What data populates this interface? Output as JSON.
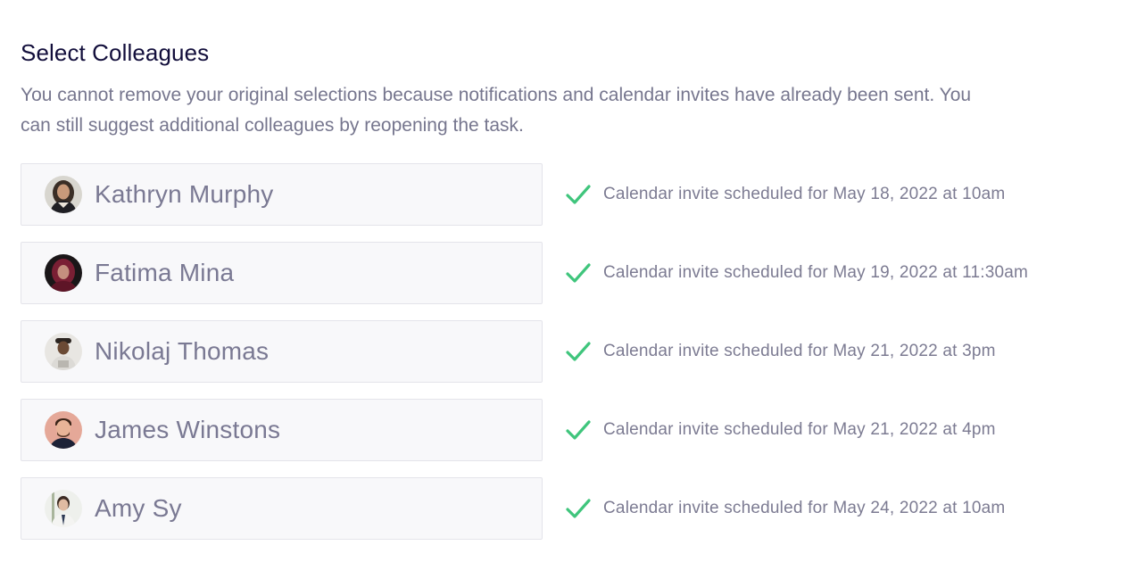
{
  "header": {
    "title": "Select Colleagues",
    "description": "You cannot remove your original selections because notifications and calendar invites have already been sent. You can still suggest additional colleagues by reopening the task."
  },
  "colors": {
    "check": "#3fc57c",
    "title": "#120e3b",
    "muted_text": "#76768e",
    "card_bg": "#f8f8fa",
    "card_border": "#e4e4ea"
  },
  "colleagues": [
    {
      "name": "Kathryn Murphy",
      "avatar_icon": "avatar-photo",
      "status_icon": "check-icon",
      "status": "Calendar invite scheduled for May 18, 2022 at 10am"
    },
    {
      "name": "Fatima Mina",
      "avatar_icon": "avatar-photo",
      "status_icon": "check-icon",
      "status": "Calendar invite scheduled for May 19, 2022 at 11:30am"
    },
    {
      "name": "Nikolaj Thomas",
      "avatar_icon": "avatar-photo",
      "status_icon": "check-icon",
      "status": "Calendar invite scheduled for May 21, 2022 at 3pm"
    },
    {
      "name": "James Winstons",
      "avatar_icon": "avatar-photo",
      "status_icon": "check-icon",
      "status": "Calendar invite scheduled for May 21, 2022 at 4pm"
    },
    {
      "name": "Amy Sy",
      "avatar_icon": "avatar-photo",
      "status_icon": "check-icon",
      "status": "Calendar invite scheduled for May 24, 2022 at 10am"
    }
  ]
}
